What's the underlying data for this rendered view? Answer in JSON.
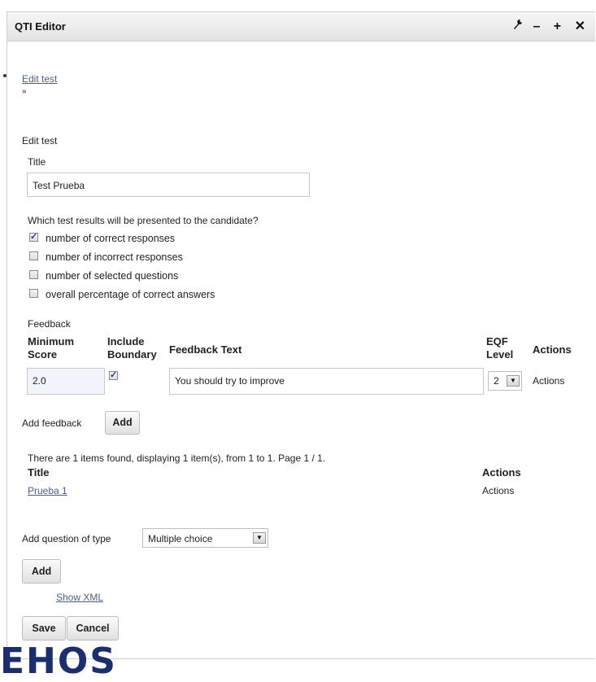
{
  "portlet": {
    "title": "QTI Editor",
    "icons": [
      "wrench-icon",
      "minimize-icon",
      "maximize-icon",
      "close-icon"
    ]
  },
  "breadcrumb": {
    "link": "Edit test",
    "separator": "»"
  },
  "form": {
    "heading": "Edit test",
    "title_label": "Title",
    "title_value": "Test Prueba",
    "results_question": "Which test results will be presented to the candidate?",
    "results_options": [
      {
        "label": "number of correct responses",
        "checked": true
      },
      {
        "label": "number of incorrect responses",
        "checked": false
      },
      {
        "label": "number of selected questions",
        "checked": false
      },
      {
        "label": "overall percentage of correct answers",
        "checked": false
      }
    ]
  },
  "feedback": {
    "label": "Feedback",
    "columns": {
      "min_score_1": "Minimum",
      "min_score_2": "Score",
      "include_1": "Include",
      "include_2": "Boundary",
      "text": "Feedback Text",
      "eqf_1": "EQF",
      "eqf_2": "Level",
      "actions": "Actions"
    },
    "row": {
      "min_score": "2.0",
      "include_boundary": true,
      "text": "You should try to improve",
      "eqf_level": "2",
      "actions": "Actions"
    },
    "add_label": "Add feedback",
    "add_button": "Add"
  },
  "items": {
    "summary": "There are 1 items found, displaying 1 item(s), from 1 to 1. Page 1 / 1.",
    "col_title": "Title",
    "col_actions": "Actions",
    "rows": [
      {
        "title": "Prueba 1",
        "actions": "Actions"
      }
    ]
  },
  "add_question": {
    "label": "Add question of type",
    "selected": "Multiple choice",
    "button": "Add"
  },
  "show_xml": "Show XML",
  "buttons": {
    "save": "Save",
    "cancel": "Cancel"
  },
  "footer_logo_text": "EHOS"
}
